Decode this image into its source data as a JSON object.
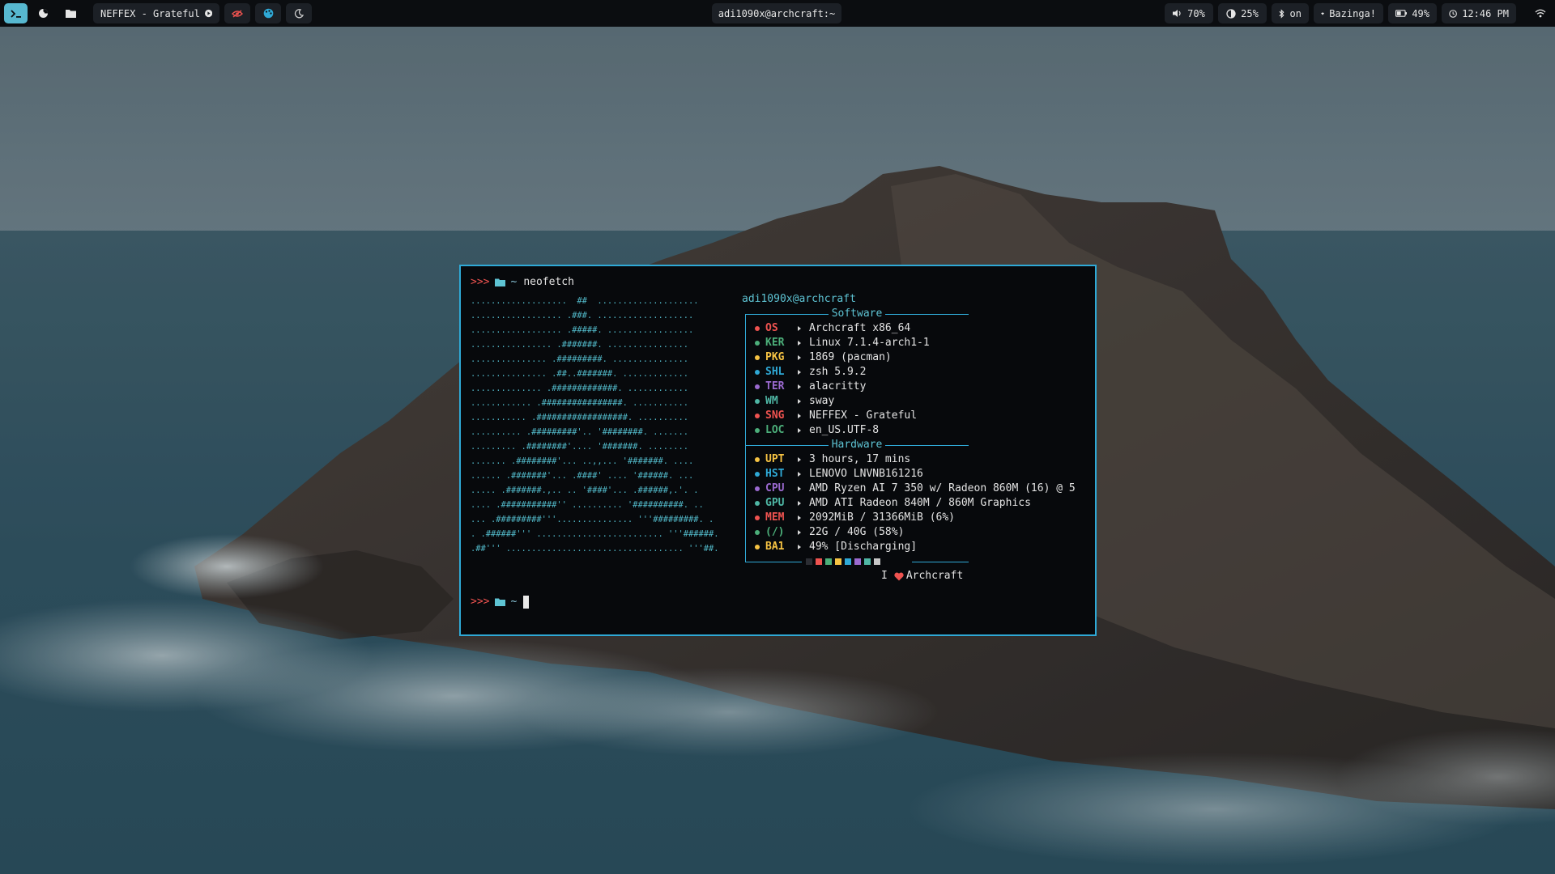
{
  "bar": {
    "workspaces": [
      {
        "icon": "terminal-icon"
      },
      {
        "icon": "firefox-icon"
      },
      {
        "icon": "folder-icon"
      }
    ],
    "media": {
      "label": "NEFFEX - Grateful",
      "icon": "play-icon"
    },
    "tray_left": [
      {
        "icon": "eye-off-icon",
        "color": "#ef5350"
      },
      {
        "icon": "palette-icon",
        "color": "#2fa9d6"
      },
      {
        "icon": "moon-icon",
        "color": "#cfcfcf"
      }
    ],
    "window_title": "adi1090x@archcraft:~",
    "status": [
      {
        "name": "volume",
        "icon": "volume-icon",
        "label": "70%"
      },
      {
        "name": "brightness",
        "icon": "brightness-icon",
        "label": "25%"
      },
      {
        "name": "bluetooth",
        "icon": "bluetooth-icon",
        "label": "on"
      },
      {
        "name": "network",
        "icon": "wifi-icon",
        "label": "Bazinga!"
      },
      {
        "name": "battery",
        "icon": "battery-icon",
        "label": "49%"
      },
      {
        "name": "clock",
        "icon": "clock-icon",
        "label": "12:46 PM"
      }
    ]
  },
  "terminal": {
    "prompt_symbol": ">>>",
    "tilde": "~",
    "command": "neofetch",
    "user": "adi1090x",
    "at_host": "@archcraft",
    "ascii_art": [
      "...................  ##  ....................",
      ".................. .###. ...................",
      ".................. .#####. .................",
      "................ .#######. ................",
      "............... .#########. ...............",
      "............... .##..#######. .............",
      ".............. .#############. ............",
      "............ .################. ...........",
      "........... .##################. ..........",
      ".......... .#########'.. '########. .......",
      "......... .########'.... '#######. ........",
      "....... .########'... ..,,... '#######. ....",
      "...... .#######'... .####' .... '######. ...",
      "..... .#######.,.. .. '####'... .######,.'. .",
      ".... .###########'' .......... '##########. ..",
      "... .#########'''............... '''#########. .",
      ". .######''' ......................... '''######.",
      ".##''' ................................... '''##."
    ],
    "sections": [
      {
        "title": "Software",
        "rows": [
          {
            "key": "OS",
            "value": "Archcraft x86_64",
            "color": "#ef5350"
          },
          {
            "key": "KER",
            "value": "Linux 7.1.4-arch1-1",
            "color": "#4caf7a"
          },
          {
            "key": "PKG",
            "value": "1869 (pacman)",
            "color": "#f6c343"
          },
          {
            "key": "SHL",
            "value": "zsh 5.9.2",
            "color": "#2fa9d6"
          },
          {
            "key": "TER",
            "value": "alacritty",
            "color": "#9b6ad0"
          },
          {
            "key": "WM",
            "value": "sway",
            "color": "#4fb7a5"
          },
          {
            "key": "SNG",
            "value": "NEFFEX - Grateful",
            "color": "#ef5350"
          },
          {
            "key": "LOC",
            "value": "en_US.UTF-8",
            "color": "#4caf7a"
          }
        ]
      },
      {
        "title": "Hardware",
        "rows": [
          {
            "key": "UPT",
            "value": "3 hours, 17 mins",
            "color": "#f6c343"
          },
          {
            "key": "HST",
            "value": "LENOVO LNVNB161216",
            "color": "#2fa9d6"
          },
          {
            "key": "CPU",
            "value": "AMD Ryzen AI 7 350 w/ Radeon 860M (16) @ 5",
            "color": "#9b6ad0"
          },
          {
            "key": "GPU",
            "value": "AMD ATI Radeon 840M / 860M Graphics",
            "color": "#4fb7a5"
          },
          {
            "key": "MEM",
            "value": "2092MiB / 31366MiB (6%)",
            "color": "#ef5350"
          },
          {
            "key": "(/)",
            "value": "22G / 40G (58%)",
            "color": "#4caf7a"
          },
          {
            "key": "BA1",
            "value": "49% [Discharging]",
            "color": "#f6c343"
          }
        ]
      }
    ],
    "palette": [
      "#2b2d33",
      "#ef5350",
      "#4caf7a",
      "#f6c343",
      "#2fa9d6",
      "#9b6ad0",
      "#4fb7a5",
      "#c8c8c8"
    ],
    "footer_prefix": "I",
    "footer_suffix": "Archcraft",
    "heart_color": "#ef5350"
  }
}
